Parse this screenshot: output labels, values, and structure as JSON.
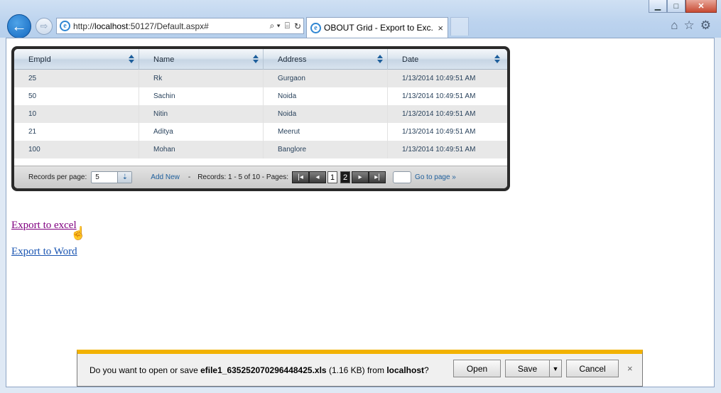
{
  "browser": {
    "address_protocol": "http://",
    "address_host": "localhost",
    "address_rest": ":50127/Default.aspx#",
    "tab_title": "OBOUT Grid - Export to Exc...",
    "tab_close": "×",
    "window_buttons": {
      "minimize": "▁",
      "maximize": "□",
      "close": "✕"
    },
    "nav": {
      "back": "←",
      "forward": "⇨"
    },
    "address_tools": {
      "search": "⌕ ▾",
      "compat": "⌸",
      "refresh": "↻"
    },
    "right_tools": {
      "home": "⌂",
      "favorites": "☆",
      "settings": "⚙"
    }
  },
  "grid": {
    "columns": [
      "EmpId",
      "Name",
      "Address",
      "Date"
    ],
    "rows": [
      [
        "25",
        "Rk",
        "Gurgaon",
        "1/13/2014 10:49:51 AM"
      ],
      [
        "50",
        "Sachin",
        "Noida",
        "1/13/2014 10:49:51 AM"
      ],
      [
        "10",
        "Nitin",
        "Noida",
        "1/13/2014 10:49:51 AM"
      ],
      [
        "21",
        "Aditya",
        "Meerut",
        "1/13/2014 10:49:51 AM"
      ],
      [
        "100",
        "Mohan",
        "Banglore",
        "1/13/2014 10:49:51 AM"
      ]
    ],
    "footer": {
      "records_per_page_label": "Records per page:",
      "records_per_page_value": "5",
      "add_new": "Add New",
      "separator": "-",
      "records_text": "Records: 1 - 5 of 10 - Pages:",
      "pager": {
        "first": "|◂",
        "prev": "◂",
        "page1": "1",
        "page2": "2",
        "next": "▸",
        "last": "▸|"
      },
      "go_to_page": "Go to page »"
    }
  },
  "links": {
    "export_excel": "Export to excel",
    "export_word": "Export to Word"
  },
  "download_bar": {
    "prompt_prefix": "Do you want to open or save ",
    "filename": "efile1_635252070296448425.xls",
    "size": " (1.16 KB) from ",
    "source": "localhost",
    "prompt_suffix": "?",
    "open_label": "Open",
    "save_label": "Save",
    "save_dropdown": "▼",
    "cancel_label": "Cancel",
    "close_label": "×"
  },
  "colors": {
    "download_bar_accent": "#f2b200",
    "visited_link": "#800080",
    "link": "#1a55b2"
  }
}
